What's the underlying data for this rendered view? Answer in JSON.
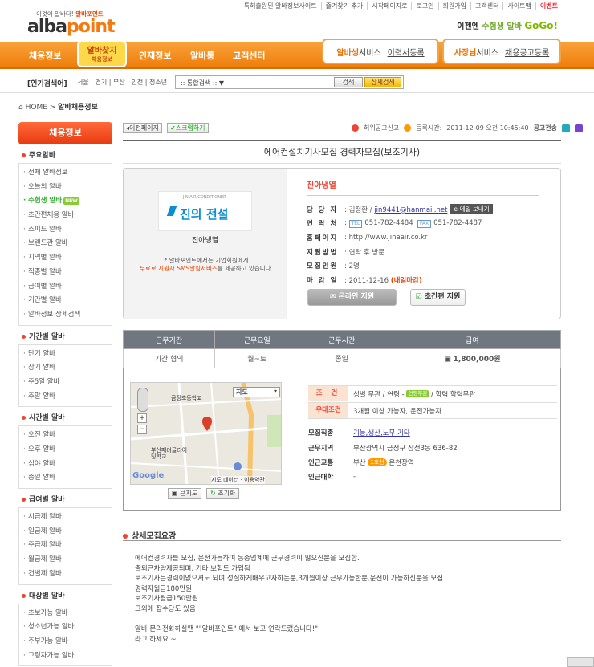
{
  "top_links": [
    "특허출원된 알바정보사이트",
    "즐겨찾기 추가",
    "시작페이지로",
    "로그인",
    "회원가입",
    "고객센터",
    "사이트맵",
    "이벤트"
  ],
  "logo": {
    "tagline_pre": "이것이 알바다!",
    "tagline_brand": "알바포인트",
    "name_a": "alba",
    "name_b": "point"
  },
  "slogan": {
    "pre": "이젠엔",
    "mid": "수험생 알바",
    "go": "GoGo!"
  },
  "nav": {
    "items": [
      "채용정보",
      "인재정보",
      "알바통",
      "고객센터"
    ],
    "badge": "알바찾지",
    "badge_sub": "채용정보"
  },
  "services": [
    {
      "title_a": "알바생",
      "title_b": "서비스",
      "link": "이력서등록"
    },
    {
      "title_a": "사장님",
      "title_b": "서비스",
      "link": "채용공고등록"
    }
  ],
  "search": {
    "label": "[인기검색어]",
    "keywords": "서울 | 경기 | 부산 | 인천 | 청소년",
    "select": ":: 통합검색 ::",
    "btn": "검색",
    "btn_detail": "상세검색"
  },
  "breadcrumb": {
    "home": "HOME",
    "current": "알바채용정보"
  },
  "sidebar": {
    "head": "채용정보",
    "groups": [
      {
        "title": "주요알바",
        "items": [
          "전체 알바정보",
          "오늘의 알바",
          "수험생 알바",
          "초간편채용 알바",
          "스피드 알바",
          "브랜드관 알바",
          "지역별 알바",
          "직종별 알바",
          "급여별 알바",
          "기간별 알바",
          "알바정보 상세검색"
        ]
      },
      {
        "title": "기간별 알바",
        "items": [
          "단기 알바",
          "장기 알바",
          "주5일 알바",
          "주말 알바"
        ]
      },
      {
        "title": "시간별 알바",
        "items": [
          "오전 알바",
          "오후 알바",
          "심야 알바",
          "종일 알바"
        ]
      },
      {
        "title": "급여별 알바",
        "items": [
          "시급제 알바",
          "일급제 알바",
          "주급제 알바",
          "월급제 알바",
          "건별제 알바"
        ]
      },
      {
        "title": "대상별 알바",
        "items": [
          "초보가능 알바",
          "청소년가능 알바",
          "주부가능 알바",
          "고령자가능 알바"
        ]
      }
    ],
    "new_tag": "NEW"
  },
  "actions": {
    "prev": "이전페이지",
    "scrap": "스크랩하기",
    "report": "허위공고신고",
    "reg_label": "등록시간:",
    "reg_time": "2011-12-09 오전 10:45:40",
    "share": "공고전송"
  },
  "title": "에어컨설치기사모집 경력자모집(보조기사)",
  "company": {
    "logo_text": "진의 전설",
    "logo_small": "JIN AIR CONDITIONER",
    "name": "진아냉열",
    "note_a": "* 알바포인트에서는 기업회원에게",
    "note_b": "무료로 지원자 SMS알림서비스",
    "note_c": "를 제공하고 있습니다.",
    "contact_name": "진아냉열",
    "manager_label": "담 당 자",
    "manager": "김정환 /",
    "email": "jin9441@hanmail.net",
    "email_btn": "e-메일 보내기",
    "phone_label": "연 락 처",
    "tel_tag": "TEL",
    "tel": "051-782-4484",
    "fax_tag": "FAX",
    "fax": "051-782-4487",
    "home_label": "홈페이지",
    "home": "http://www.jinaair.co.kr",
    "method_label": "지원방법",
    "method": "연락 후 방문",
    "count_label": "모집인원",
    "count": "2명",
    "deadline_label": "마 감 일",
    "deadline": "2011-12-16",
    "deadline_note": "(내일마감)",
    "apply_online": "온라인 지원",
    "apply_simple": "초간편 지원"
  },
  "work_table": {
    "headers": [
      "근무기간",
      "근무요일",
      "근무시간",
      "급여"
    ],
    "values": [
      "기간 협의",
      "월~토",
      "종일",
      "1,800,000원"
    ]
  },
  "map": {
    "dropdown": "지도",
    "label1": "금정초등학교",
    "label2": "부산패러글라이딩학교",
    "credit": "지도 데이터 · 이용약관",
    "brand": "Google",
    "btn_big": "큰지도",
    "btn_reset": "초기화"
  },
  "info": {
    "cond_label": "조 건",
    "cond_pre": "성별 무관 / 연령 -",
    "cond_tag": "연령무관",
    "cond_post": "/ 학력 학력무관",
    "pref_label": "우대조건",
    "pref": "3개월 이상 가능자, 운전가능자",
    "job_label": "모집직종",
    "job": "기능,생산,노무 기타",
    "area_label": "근무지역",
    "area": "부산광역시 금정구 장전3동 636-82",
    "traffic_label": "인근교통",
    "traffic_pre": "부산",
    "traffic_line": "1호선",
    "traffic_post": "온천장역",
    "univ_label": "인근대학",
    "univ": "-"
  },
  "details": {
    "heading": "상세모집요강",
    "text": "에어컨경력자를 모집, 운전가능하며 동종업계에 근무경력이 많으신분을 모집함.\n출퇴근차량제공되며, 기타 보험도 가입됨\n보조기사는경력이없으셔도 되며 성실하게배우고자하는분,3개월이상 근무가능한분,운전이 가능하신분을 모집\n경력자월급180만원\n보조기사월급150만원\n그외에 잡수당도 있음\n\n알바 문의전화하실땐 \"\"알바포인트\" 에서 보고 연락드렸습니다!\"\n라고 하세요 ~"
  },
  "colors": {
    "brand": "#f47a10",
    "accent": "#e43"
  }
}
